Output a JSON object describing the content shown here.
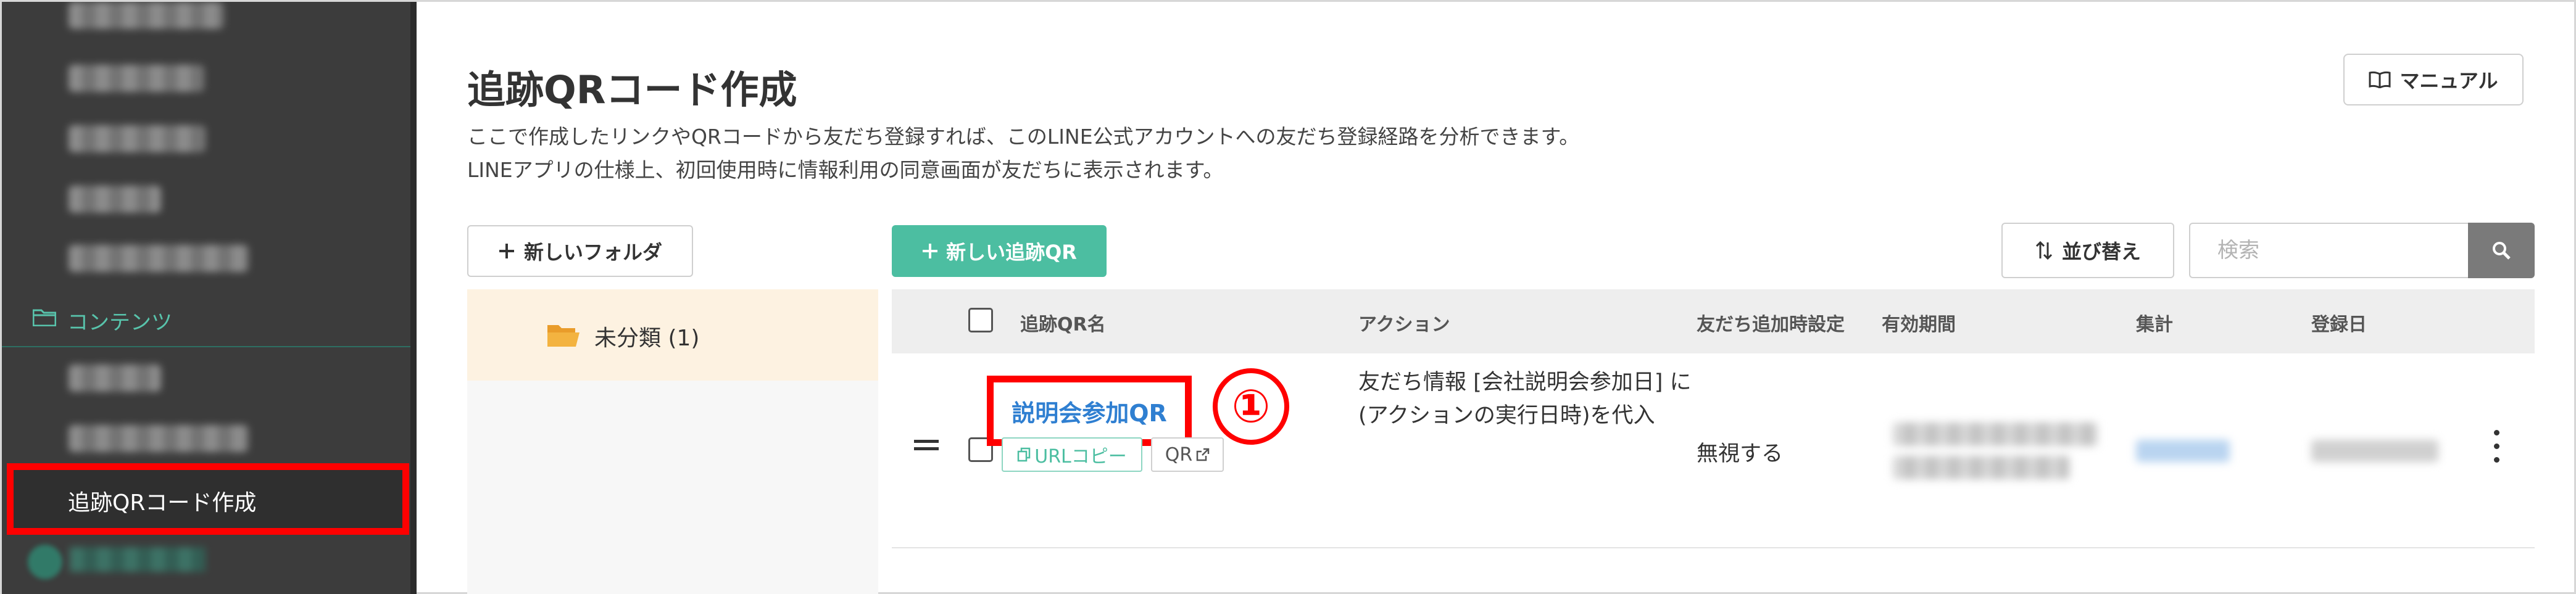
{
  "sidebar": {
    "section_label": "コンテンツ",
    "active_item_label": "追跡QRコード作成",
    "icons": {
      "section": "folder-icon"
    }
  },
  "header": {
    "title": "追跡QRコード作成",
    "description_line1": "ここで作成したリンクやQRコードから友だち登録すれば、このLINE公式アカウントへの友だち登録経路を分析できます。",
    "description_line2": "LINEアプリの仕様上、初回使用時に情報利用の同意画面が友だちに表示されます。",
    "manual_label": "マニュアル"
  },
  "toolbar": {
    "new_folder_label": "新しいフォルダ",
    "new_qr_label": "新しい追跡QR",
    "sort_label": "並び替え",
    "search_placeholder": "検索"
  },
  "folders": [
    {
      "label": "未分類 (1)"
    }
  ],
  "table": {
    "columns": [
      "追跡QR名",
      "アクション",
      "友だち追加時設定",
      "有効期間",
      "集計",
      "登録日"
    ],
    "rows": [
      {
        "name": "説明会参加QR",
        "url_copy_label": "URLコピー",
        "qr_label": "QR",
        "action": "友だち情報 [会社説明会参加日] に(アクションの実行日時)を代入",
        "friend_setting": "無視する"
      }
    ]
  },
  "annotation": {
    "step_number": "①"
  },
  "colors": {
    "sidebar_bg": "#3c3c3c",
    "accent_green": "#4cbea1",
    "link_blue": "#2f7fd1",
    "highlight_red": "#ff0000",
    "folder_row_bg": "#fdf2e1"
  }
}
